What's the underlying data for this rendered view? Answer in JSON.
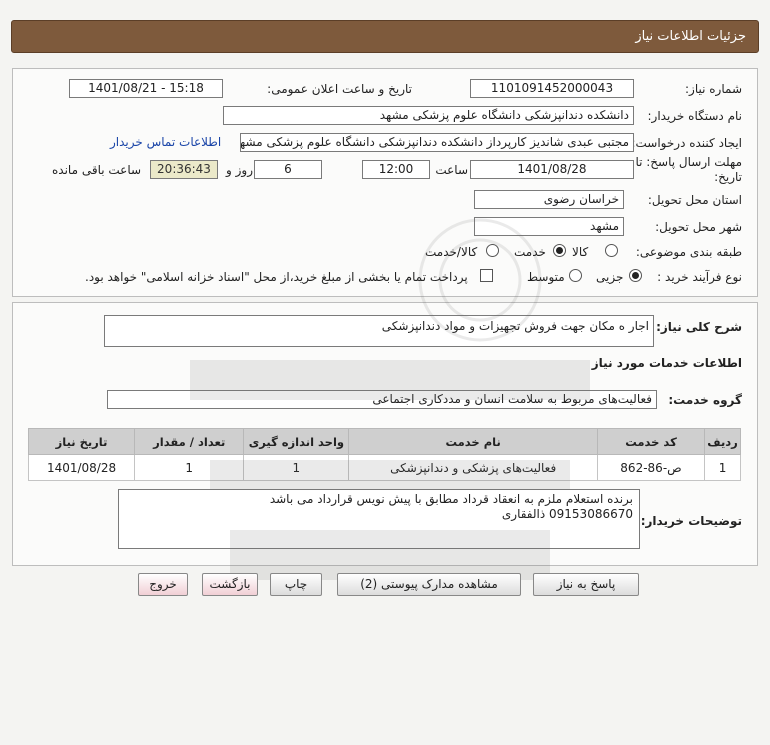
{
  "header": {
    "title": "جزئیات اطلاعات نیاز"
  },
  "form": {
    "need_number_label": "شماره نیاز:",
    "need_number": "1101091452000043",
    "announce_label": "تاریخ و ساعت اعلان عمومی:",
    "announce_value": "1401/08/21 - 15:18",
    "buyer_org_label": "نام دستگاه خریدار:",
    "buyer_org": "دانشکده دندانپزشکی   دانشگاه علوم پزشکی مشهد",
    "creator_label": "ایجاد کننده درخواست:",
    "creator": "مجتبی عبدی شاندیز کارپرداز دانشکده دندانپزشکی   دانشگاه علوم پزشکی مشهد",
    "contact_link": "اطلاعات تماس خریدار",
    "deadline_label": "مهلت ارسال پاسخ: تا تاریخ:",
    "deadline_date": "1401/08/28",
    "time_label": "ساعت",
    "deadline_time": "12:00",
    "days_value": "6",
    "days_label": "روز و",
    "remaining_value": "20:36:43",
    "remaining_label": "ساعت باقی مانده",
    "province_label": "استان محل تحویل:",
    "province": "خراسان رضوی",
    "city_label": "شهر محل تحویل:",
    "city": "مشهد",
    "category_label": "طبقه بندی موضوعی:",
    "category_options": [
      "کالا",
      "خدمت",
      "کالا/خدمت"
    ],
    "category_selected": "خدمت",
    "process_label": "نوع فرآیند خرید :",
    "process_options": [
      "جزیی",
      "متوسط"
    ],
    "process_selected": "جزیی",
    "payment_note": "پرداخت تمام یا بخشی از مبلغ خرید،از محل \"اسناد خزانه اسلامی\" خواهد بود."
  },
  "description": {
    "label": "شرح کلی نیاز:",
    "value": "اجار ه مکان جهت فروش تجهیزات و مواد دندانپزشکی"
  },
  "services": {
    "section_title": "اطلاعات خدمات مورد نیاز",
    "group_label": "گروه خدمت:",
    "group_value": "فعالیت‌های مربوط به سلامت انسان و مددکاری اجتماعی",
    "columns": [
      "ردیف",
      "کد خدمت",
      "نام خدمت",
      "واحد اندازه گیری",
      "تعداد / مقدار",
      "تاریخ نیاز"
    ],
    "rows": [
      [
        "1",
        "ص-86-862",
        "فعالیت‌های پزشکی و دندانپزشکی",
        "1",
        "1",
        "1401/08/28"
      ]
    ]
  },
  "buyer_notes": {
    "label": "توضیحات خریدار:",
    "line1": "برنده استعلام ملزم به انعقاد قرداد مطابق با پیش نویس قرارداد می باشد",
    "line2": "09153086670 ذالفقاری"
  },
  "buttons": {
    "reply": "پاسخ به نیاز",
    "attachments": "مشاهده مدارک پیوستی (2)",
    "print": "چاپ",
    "back": "بازگشت",
    "exit": "خروج"
  }
}
